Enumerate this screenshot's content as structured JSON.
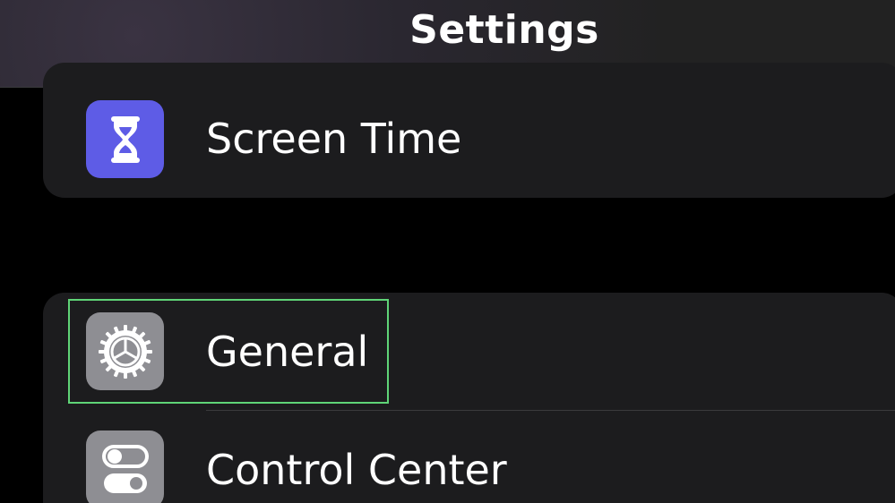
{
  "header": {
    "title": "Settings"
  },
  "groups": [
    {
      "items": [
        {
          "label": "Screen Time",
          "icon": "hourglass-icon",
          "icon_color": "#5e5ce6"
        }
      ]
    },
    {
      "items": [
        {
          "label": "General",
          "icon": "gear-icon",
          "icon_color": "#8e8e93",
          "highlighted": true
        },
        {
          "label": "Control Center",
          "icon": "switches-icon",
          "icon_color": "#8e8e93"
        }
      ]
    }
  ],
  "colors": {
    "background": "#000000",
    "group_background": "#1c1c1e",
    "text": "#ffffff",
    "highlight_border": "#5fd477"
  }
}
